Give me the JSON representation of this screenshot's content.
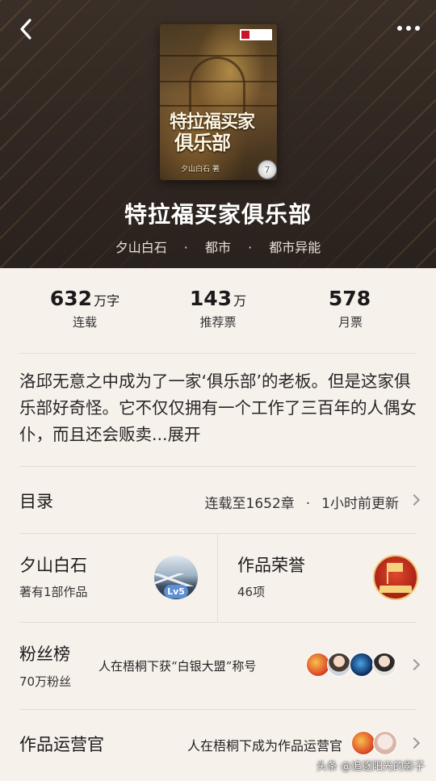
{
  "book": {
    "title": "特拉福买家俱乐部",
    "author": "夕山白石",
    "genre": "都市",
    "subgenre": "都市异能",
    "meta_separator": "·",
    "cover": {
      "title_line1": "特拉福买家",
      "title_line2": "俱乐部",
      "author_text": "夕山白石 著",
      "disc_label": "7"
    }
  },
  "stats": [
    {
      "value": "632",
      "unit": "万字",
      "label": "连载"
    },
    {
      "value": "143",
      "unit": "万",
      "label": "推荐票"
    },
    {
      "value": "578",
      "unit": "",
      "label": "月票"
    }
  ],
  "summary": {
    "text": "洛邱无意之中成为了一家‘俱乐部’的老板。但是这家俱乐部好奇怪。它不仅仅拥有一个工作了三百年的人偶女仆，而且还会贩卖...",
    "expand_label": "展开"
  },
  "catalog": {
    "title": "目录",
    "chapter_status": "连载至1652章",
    "separator": "·",
    "updated": "1小时前更新"
  },
  "author_card": {
    "name": "夕山白石",
    "works": "著有1部作品",
    "level": "Lv5"
  },
  "honors_card": {
    "title": "作品荣誉",
    "count": "46项"
  },
  "fans": {
    "title": "粉丝榜",
    "count": "70万粉丝",
    "highlight": "人在梧桐下获“白银大盟”称号"
  },
  "operator": {
    "title": "作品运营官",
    "text": "人在梧桐下成为作品运营官"
  },
  "watermark": "头条 @追逐阳光的影子",
  "colors": {
    "header_bg": "#2f2621",
    "page_bg": "#f7f1ec",
    "level_badge": "#5b8fd6",
    "medal_red": "#b5281a"
  }
}
